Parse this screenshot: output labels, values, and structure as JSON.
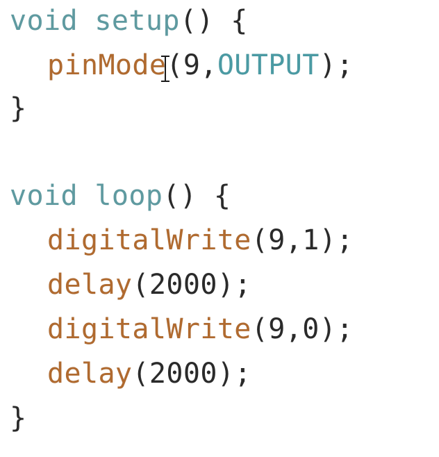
{
  "code": {
    "setup": {
      "kw_void": "void",
      "name": "setup",
      "parens": "()",
      "open_brace": "{",
      "pinmode_fn": "pinMode",
      "pinmode_open": "(",
      "pinmode_pin": "9",
      "comma": ",",
      "pinmode_mode": "OUTPUT",
      "pinmode_close": ");",
      "close_brace": "}"
    },
    "loop": {
      "kw_void": "void",
      "name": "loop",
      "parens": "()",
      "open_brace": "{",
      "write1_fn": "digitalWrite",
      "write1_args": "(9,1);",
      "delay1_fn": "delay",
      "delay1_args": "(2000);",
      "write2_fn": "digitalWrite",
      "write2_args": "(9,0);",
      "delay2_fn": "delay",
      "delay2_args": "(2000);",
      "close_brace": "}"
    }
  },
  "colors": {
    "keyword": "#5e9aa0",
    "function": "#b06a2f",
    "constant": "#4a9aa3",
    "text": "#2a2a2a",
    "background": "#ffffff"
  },
  "icons": {
    "cursor": "text-cursor-ibeam-icon"
  }
}
